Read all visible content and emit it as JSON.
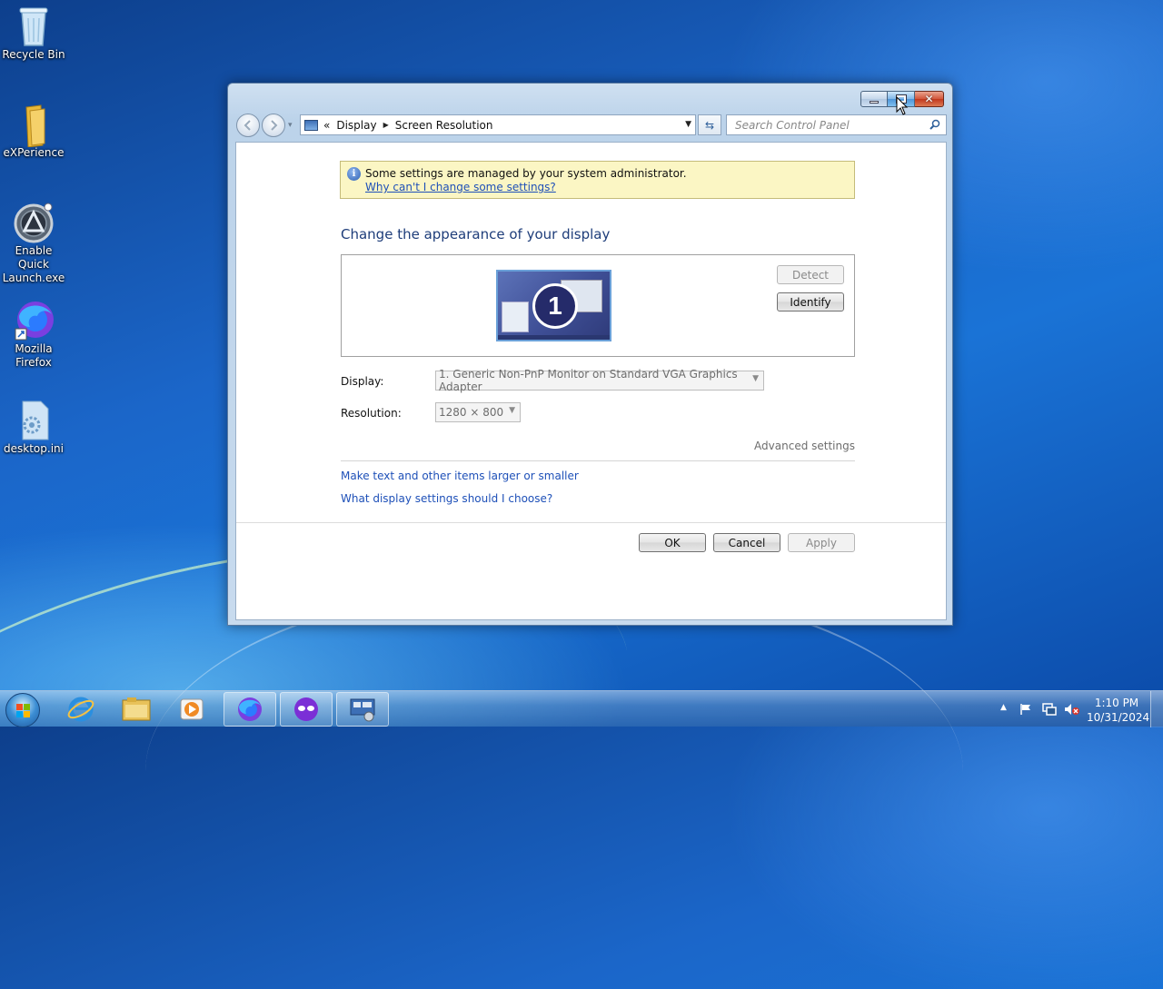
{
  "desktop": {
    "icons": [
      {
        "label": "Recycle Bin",
        "icon": "recycle-bin-icon"
      },
      {
        "label": "eXPerience",
        "icon": "folder-icon"
      },
      {
        "label": "Enable Quick Launch.exe",
        "icon": "quick-launch-app-icon"
      },
      {
        "label": "Mozilla Firefox",
        "icon": "firefox-icon"
      },
      {
        "label": "desktop.ini",
        "icon": "settings-file-icon"
      }
    ]
  },
  "window": {
    "breadcrumb": [
      "Display",
      "Screen Resolution"
    ],
    "breadcrumb_prefix": "«",
    "search_placeholder": "Search Control Panel",
    "info": {
      "message": "Some settings are managed by your system administrator.",
      "link": "Why can't I change some settings?"
    },
    "heading": "Change the appearance of your display",
    "monitor_number": "1",
    "buttons": {
      "detect": "Detect",
      "identify": "Identify",
      "ok": "OK",
      "cancel": "Cancel",
      "apply": "Apply"
    },
    "display": {
      "label": "Display:",
      "value": "1. Generic Non-PnP Monitor on Standard VGA Graphics Adapter"
    },
    "resolution": {
      "label": "Resolution:",
      "value": "1280 × 800"
    },
    "advanced": "Advanced settings",
    "links": [
      "Make text and other items larger or smaller",
      "What display settings should I choose?"
    ]
  },
  "taskbar": {
    "time": "1:10 PM",
    "date": "10/31/2024"
  },
  "colors": {
    "accent_link": "#1e50b8",
    "heading": "#1e3d7a",
    "info_bg": "#fbf6c4"
  }
}
